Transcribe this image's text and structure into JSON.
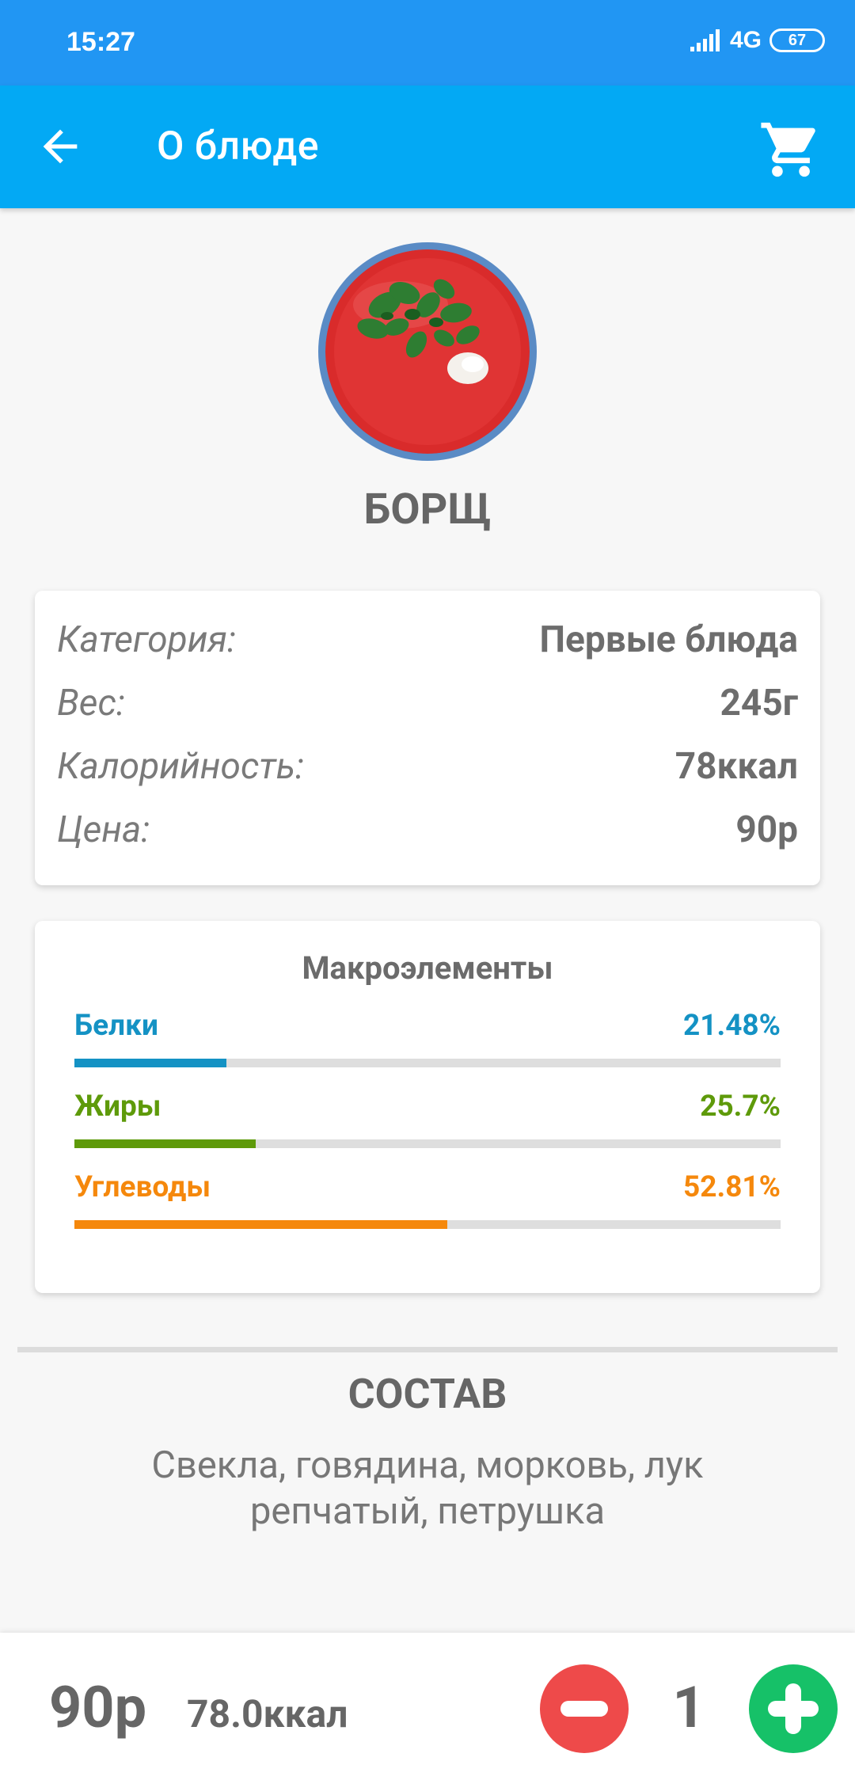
{
  "status": {
    "time": "15:27",
    "network": "4G",
    "battery": "67"
  },
  "appbar": {
    "title": "О блюде",
    "back_icon": "arrow-back-icon",
    "cart_icon": "cart-icon"
  },
  "dish": {
    "name": "БОРЩ",
    "image_icon": "borscht-plate-icon"
  },
  "info": {
    "rows": [
      {
        "label": "Категория:",
        "value": "Первые блюда"
      },
      {
        "label": "Вес:",
        "value": "245г"
      },
      {
        "label": "Калорийность:",
        "value": "78ккал"
      },
      {
        "label": "Цена:",
        "value": "90р"
      }
    ]
  },
  "macros": {
    "title": "Макроэлементы",
    "items": [
      {
        "label": "Белки",
        "value": "21.48%",
        "percent": 21.48,
        "color": "#1492c4"
      },
      {
        "label": "Жиры",
        "value": "25.7%",
        "percent": 25.7,
        "color": "#5e9a0a"
      },
      {
        "label": "Углеводы",
        "value": "52.81%",
        "percent": 52.81,
        "color": "#f5880c"
      }
    ]
  },
  "composition": {
    "title": "СОСТАВ",
    "text": "Свекла, говядина, морковь, лук репчатый, петрушка"
  },
  "bottom": {
    "price": "90р",
    "kcal": "78.0ккал",
    "quantity": "1",
    "minus_icon": "minus-icon",
    "plus_icon": "plus-icon"
  },
  "colors": {
    "status_bar": "#2196f3",
    "app_bar": "#03a9f4",
    "minus": "#ee4a4a",
    "plus": "#16c168"
  }
}
